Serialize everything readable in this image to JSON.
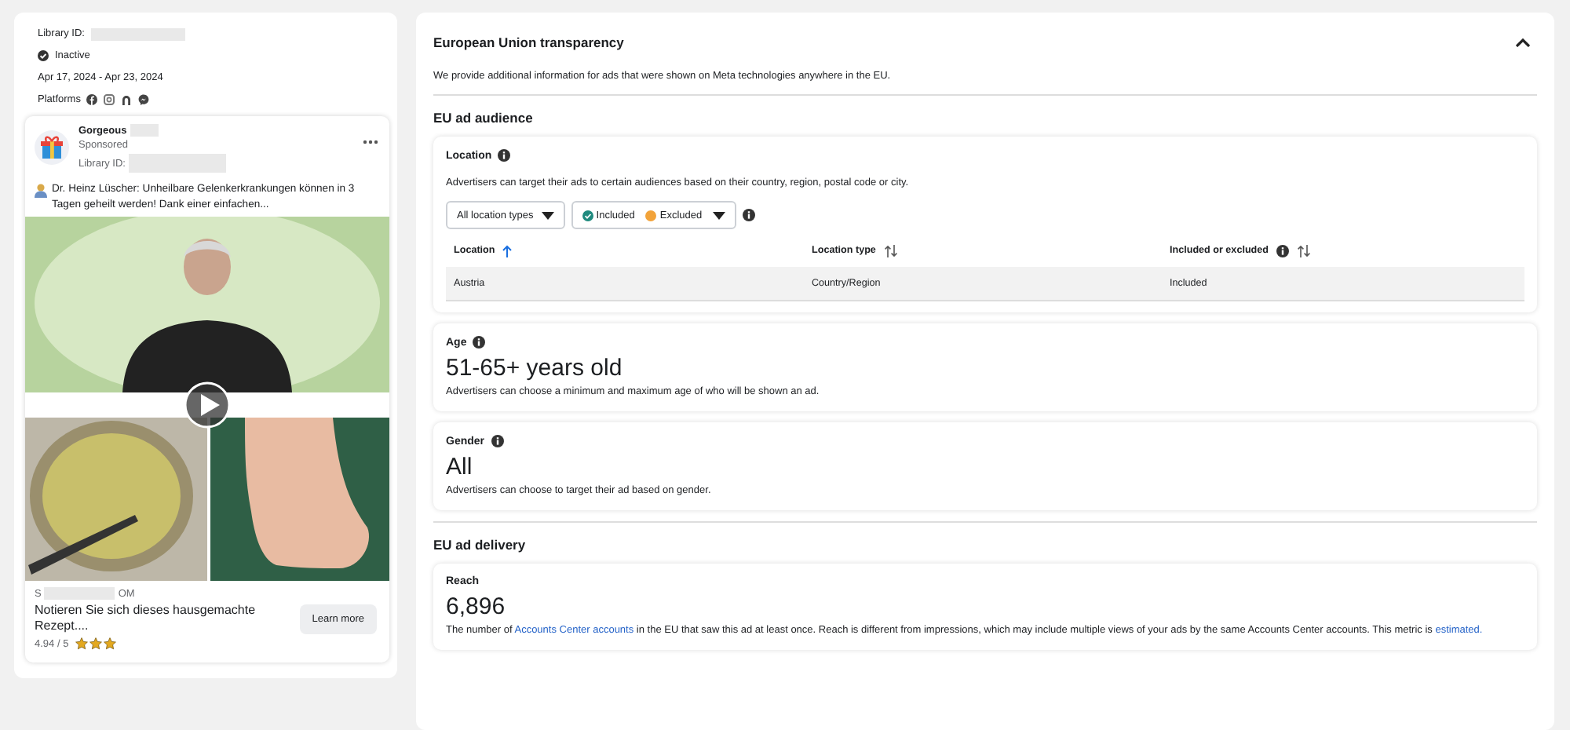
{
  "ad_summary": {
    "library_id_label": "Library ID:",
    "status": "Inactive",
    "date_range": "Apr 17, 2024 - Apr 23, 2024",
    "platforms_label": "Platforms"
  },
  "ad_preview": {
    "advertiser": "Gorgeous",
    "sponsored": "Sponsored",
    "library_id_label": "Library ID:",
    "body": "Dr. Heinz Lüscher: Unheilbare Gelenkerkrankungen können in 3 Tagen geheilt werden! Dank einer einfachen...",
    "link_start": "S",
    "link_end": "OM",
    "headline": "Notieren Sie sich dieses hausgemachte Rezept....",
    "rating": "4.94 / 5",
    "stars": 3,
    "cta": "Learn more"
  },
  "eu_transparency": {
    "title": "European Union transparency",
    "expanded": true,
    "description": "We provide additional information for ads that were shown on Meta technologies anywhere in the EU.",
    "audience_heading": "EU ad audience",
    "location": {
      "title": "Location",
      "info": true,
      "description": "Advertisers can target their ads to certain audiences based on their country, region, postal code or city.",
      "type_filter": "All location types",
      "status_filter": [
        {
          "label": "Included",
          "color": "#1f8a7e"
        },
        {
          "label": "Excluded",
          "color": "#f2a33a"
        }
      ],
      "columns": [
        {
          "label": "Location",
          "info": false,
          "sorted": true
        },
        {
          "label": "Location type",
          "info": false,
          "sorted": false
        },
        {
          "label": "Included or excluded",
          "info": true,
          "sorted": false
        }
      ],
      "rows": [
        [
          "Austria",
          "Country/Region",
          "Included"
        ]
      ]
    },
    "age": {
      "title": "Age",
      "info": true,
      "value": "51-65+ years old",
      "description": "Advertisers can choose a minimum and maximum age of who will be shown an ad."
    },
    "gender": {
      "title": "Gender",
      "info": true,
      "value": "All",
      "description": "Advertisers can choose to target their ad based on gender."
    },
    "delivery_heading": "EU ad delivery",
    "reach": {
      "title": "Reach",
      "info": false,
      "value": "6,896",
      "description": [
        {
          "text": "The number of ",
          "link": false
        },
        {
          "text": "Accounts Center accounts",
          "link": true
        },
        {
          "text": " in the EU that saw this ad at least once. Reach is different from impressions, which may include multiple views of your ads by the same Accounts Center accounts. This metric is ",
          "link": false
        },
        {
          "text": "estimated.",
          "link": true
        }
      ]
    }
  }
}
